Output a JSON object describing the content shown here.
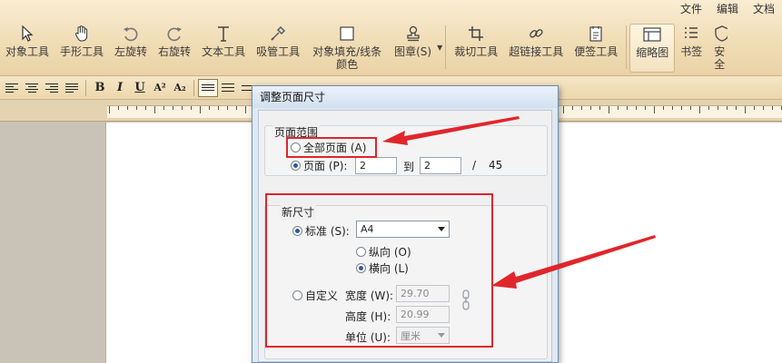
{
  "menu": [
    "文件",
    "编辑",
    "文档"
  ],
  "toolbar": {
    "tools": [
      {
        "label": "对象工具",
        "icon": "cursor-arrow-icon"
      },
      {
        "label": "手形工具",
        "icon": "hand-icon"
      },
      {
        "label": "左旋转",
        "icon": "rotate-left-icon"
      },
      {
        "label": "右旋转",
        "icon": "rotate-right-icon"
      },
      {
        "label": "文本工具",
        "icon": "text-tool-icon"
      },
      {
        "label": "吸管工具",
        "icon": "eyedropper-icon"
      },
      {
        "label": "对象填充/线条颜色",
        "icon": "fill-color-icon"
      },
      {
        "label": "图章(S)",
        "icon": "stamp-icon"
      },
      {
        "label": "裁切工具",
        "icon": "crop-icon"
      },
      {
        "label": "超链接工具",
        "icon": "link-icon"
      },
      {
        "label": "便签工具",
        "icon": "note-icon"
      },
      {
        "label": "缩略图",
        "icon": "thumbnail-icon"
      },
      {
        "label": "书签",
        "icon": "bookmark-list-icon"
      },
      {
        "label": "安全",
        "icon": "security-icon"
      }
    ]
  },
  "format": {
    "bold": "B",
    "italic": "I",
    "underline": "U",
    "superscript": "A²",
    "subscript": "A₂"
  },
  "dialog": {
    "title": "调整页面尺寸",
    "page_range": {
      "title": "页面范围",
      "all_pages": "全部页面 (A)",
      "pages": "页面 (P):",
      "from": "2",
      "to_label": "到",
      "to": "2",
      "slash": "/",
      "total": "45"
    },
    "new_size": {
      "title": "新尺寸",
      "standard": "标准 (S):",
      "standard_value": "A4",
      "portrait": "纵向 (O)",
      "landscape": "横向 (L)",
      "custom": "自定义",
      "width_label": "宽度 (W):",
      "width_value": "29.70",
      "height_label": "高度 (H):",
      "height_value": "20.99",
      "unit_label": "单位 (U):",
      "unit_value": "厘米"
    }
  },
  "colors": {
    "highlight_red": "#e0262b",
    "toolbar_bg": "#f0dcb4",
    "dialog_bg": "#f0f0f0"
  }
}
